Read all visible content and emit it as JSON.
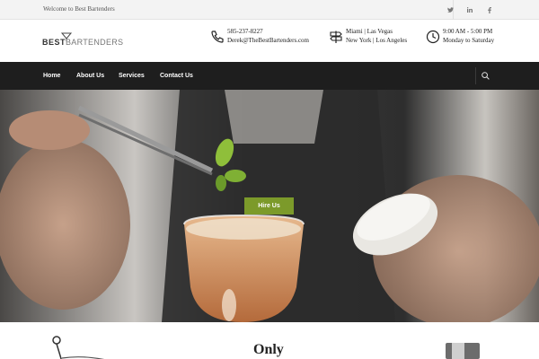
{
  "topbar": {
    "welcome": "Welcome to Best Bartenders",
    "social": [
      {
        "icon": "twitter-icon",
        "glyph": "t"
      },
      {
        "icon": "linkedin-icon",
        "glyph": "in"
      },
      {
        "icon": "facebook-icon",
        "glyph": "f"
      }
    ]
  },
  "header": {
    "logo": {
      "part1": "BEST",
      "part2": "BARTENDERS"
    },
    "contact": {
      "phone": "585-237-8227",
      "email": "Derek@TheBestBartenders.com",
      "icon": "phone-icon"
    },
    "locations": {
      "line1": "Miami | Las Vegas",
      "line2": "New York | Los Angeles",
      "icon": "signpost-icon"
    },
    "hours": {
      "line1": "9:00 AM - 5:00 PM",
      "line2": "Monday to Saturday",
      "icon": "clock-icon"
    }
  },
  "nav": {
    "items": [
      "Home",
      "About Us",
      "Services",
      "Contact Us"
    ],
    "search_icon": "search-icon"
  },
  "hero": {
    "button": "Hire Us"
  },
  "lower": {
    "heading": "Only"
  },
  "colors": {
    "nav_bg": "#1e1e1e",
    "accent": "#7c9a2a",
    "topbar_bg": "#f3f3f3"
  }
}
